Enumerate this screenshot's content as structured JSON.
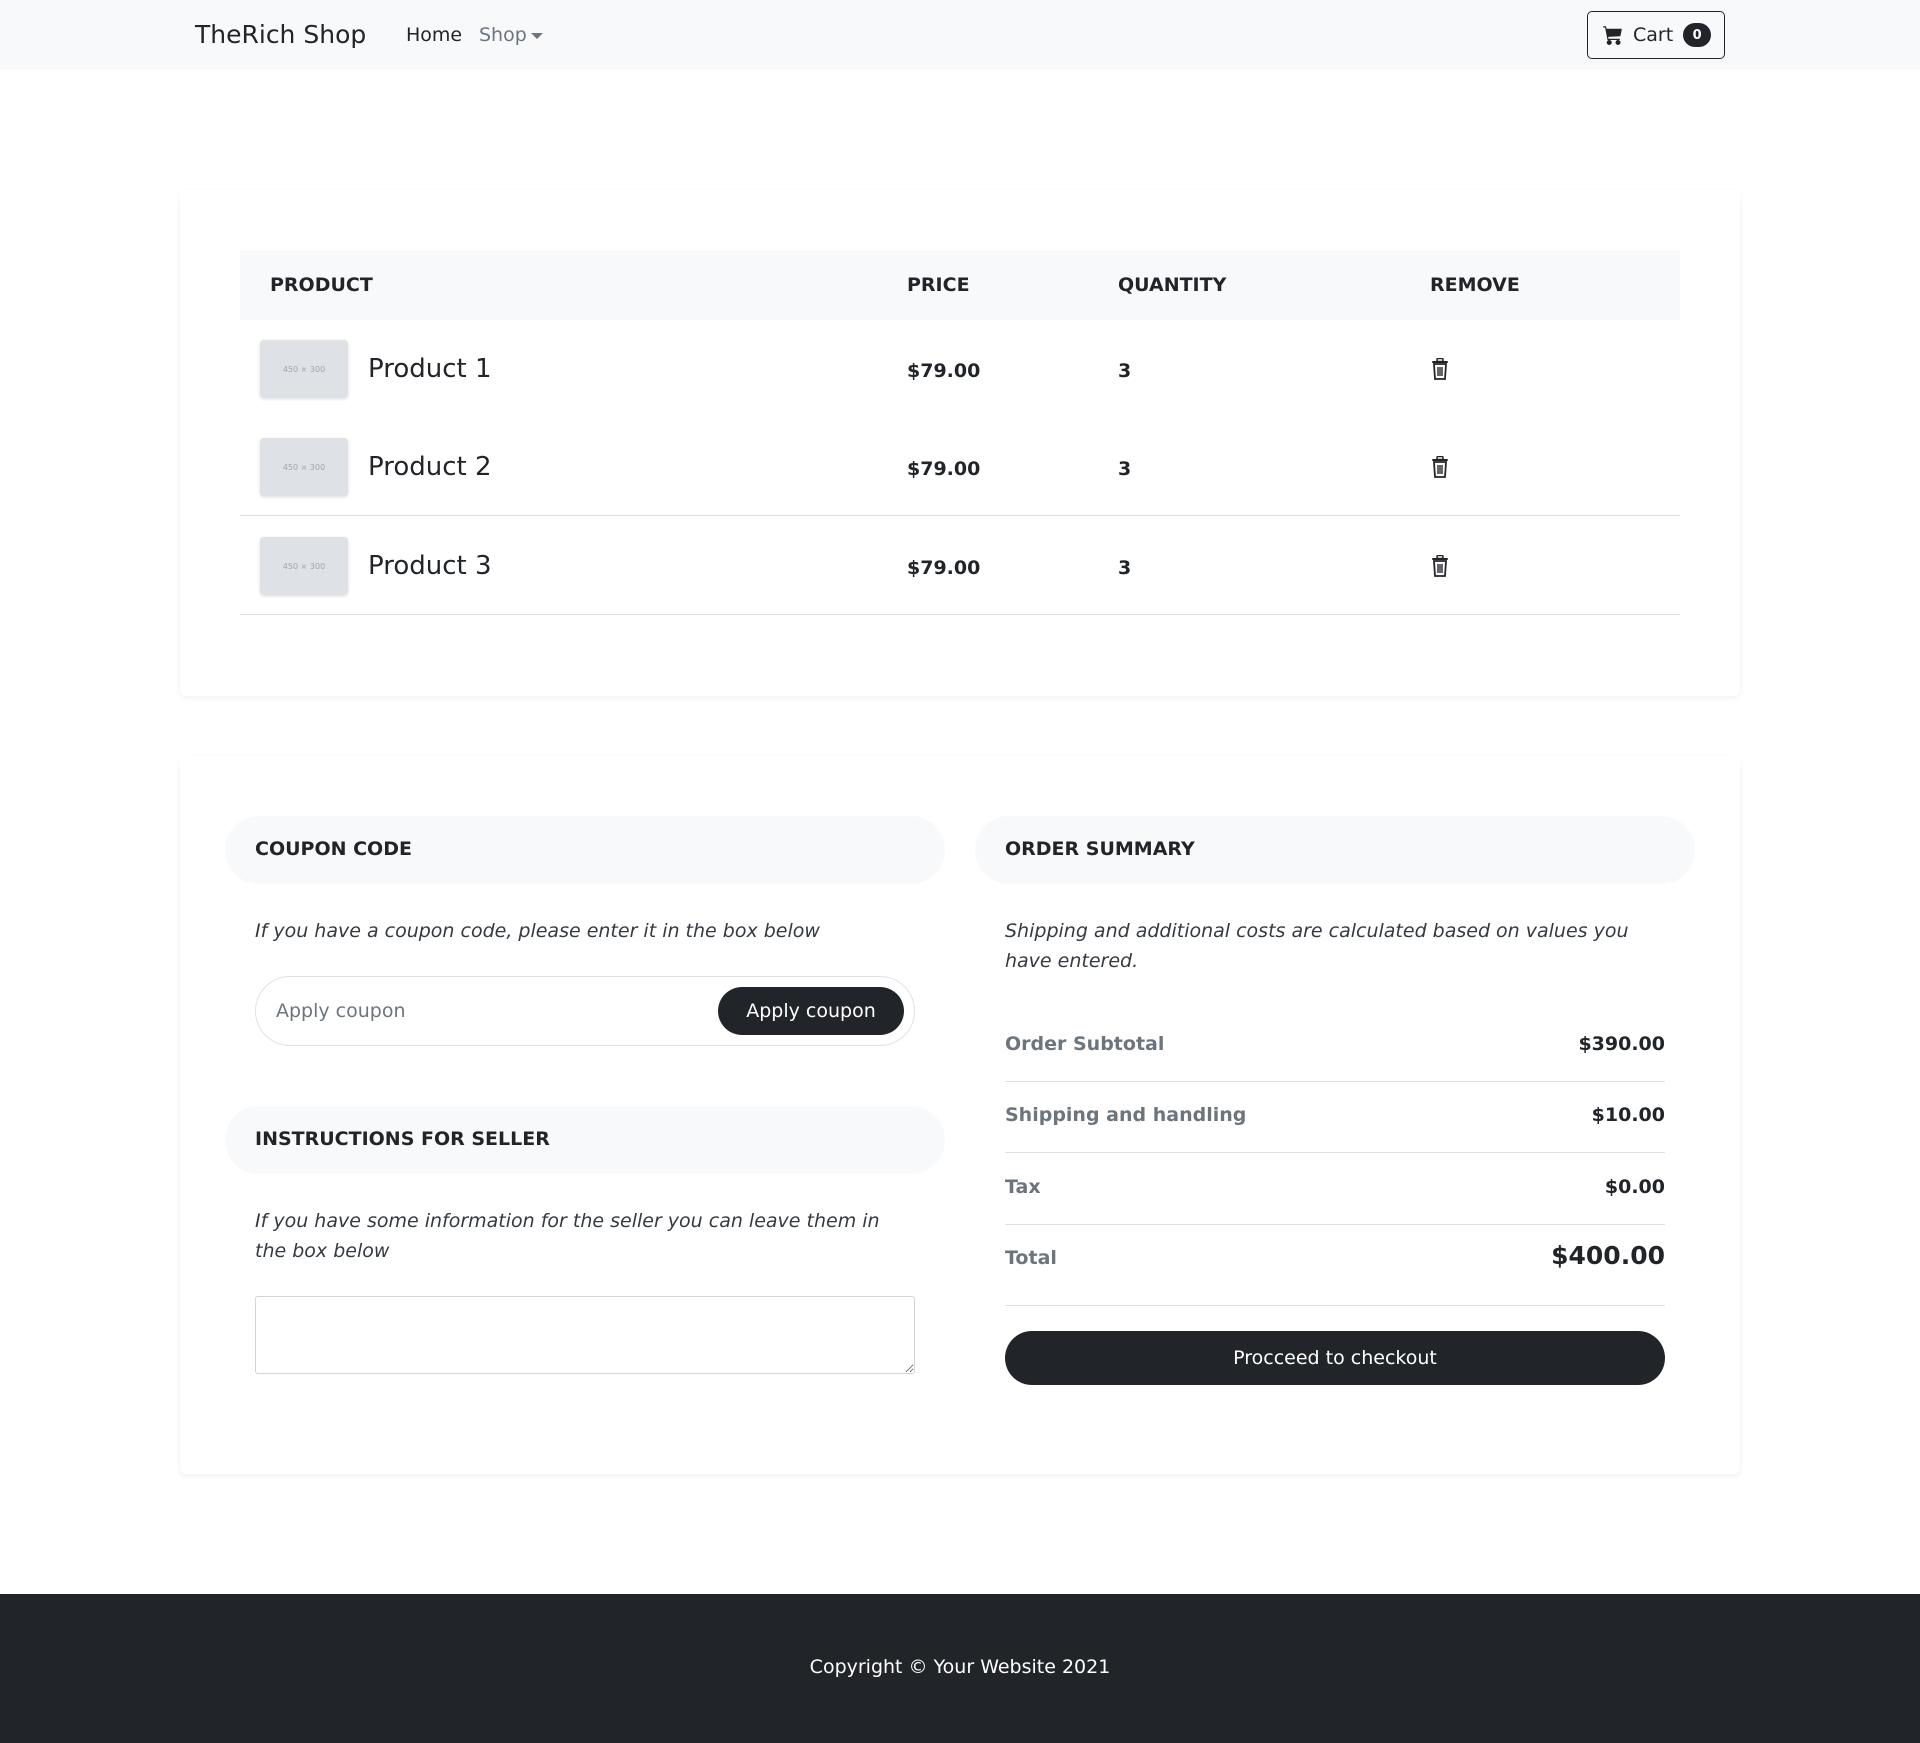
{
  "navbar": {
    "brand": "TheRich Shop",
    "home": "Home",
    "shop": "Shop",
    "cart_label": "Cart",
    "cart_count": "0"
  },
  "table": {
    "headers": {
      "product": "Product",
      "price": "Price",
      "quantity": "Quantity",
      "remove": "Remove"
    },
    "thumb_label": "450 × 300",
    "rows": [
      {
        "name": "Product 1",
        "price": "$79.00",
        "quantity": "3"
      },
      {
        "name": "Product 2",
        "price": "$79.00",
        "quantity": "3"
      },
      {
        "name": "Product 3",
        "price": "$79.00",
        "quantity": "3"
      }
    ]
  },
  "coupon": {
    "title": "Coupon code",
    "description": "If you have a coupon code, please enter it in the box below",
    "placeholder": "Apply coupon",
    "button": "Apply coupon"
  },
  "instructions": {
    "title": "Instructions for seller",
    "description": "If you have some information for the seller you can leave them in the box below"
  },
  "summary": {
    "title": "Order summary",
    "description": "Shipping and additional costs are calculated based on values you have entered.",
    "rows": [
      {
        "label": "Order Subtotal",
        "value": "$390.00"
      },
      {
        "label": "Shipping and handling",
        "value": "$10.00"
      },
      {
        "label": "Tax",
        "value": "$0.00"
      },
      {
        "label": "Total",
        "value": "$400.00"
      }
    ],
    "checkout_button": "Procceed to checkout"
  },
  "footer": {
    "copyright": "Copyright © Your Website 2021"
  }
}
